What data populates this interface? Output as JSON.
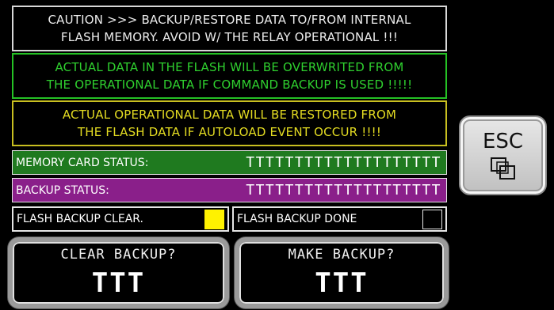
{
  "warnings": {
    "caution": {
      "line1": "CAUTION >>> BACKUP/RESTORE DATA TO/FROM INTERNAL",
      "line2": "FLASH MEMORY. AVOID W/ THE RELAY OPERATIONAL !!!"
    },
    "overwrite": {
      "line1": "ACTUAL DATA IN THE FLASH WILL BE OVERWRITED FROM",
      "line2": "THE OPERATIONAL DATA IF COMMAND BACKUP IS USED !!!!!"
    },
    "restore": {
      "line1": "ACTUAL OPERATIONAL DATA WILL BE RESTORED FROM",
      "line2": "THE FLASH DATA IF AUTOLOAD EVENT OCCUR !!!!"
    }
  },
  "memory_card": {
    "label": "MEMORY CARD STATUS:",
    "value": "TTTTTTTTTTTTTTTTTTTT"
  },
  "backup_status": {
    "label": "BACKUP STATUS:",
    "value": "TTTTTTTTTTTTTTTTTTTT"
  },
  "flags": {
    "clear": {
      "label": "FLASH BACKUP CLEAR.",
      "color": "#fff200"
    },
    "done": {
      "label": "FLASH BACKUP DONE",
      "color": "#000000"
    }
  },
  "buttons": {
    "clear_backup": {
      "title": "CLEAR BACKUP?",
      "value": "TTT"
    },
    "make_backup": {
      "title": "MAKE BACKUP?",
      "value": "TTT"
    },
    "esc": {
      "label": "ESC",
      "icon": "window-restore-icon"
    }
  },
  "colors": {
    "memory_bar": "#1f7a1f",
    "backup_bar": "#8a1f8a",
    "warn_green": "#2fd02f",
    "warn_yellow": "#e4dc22"
  }
}
